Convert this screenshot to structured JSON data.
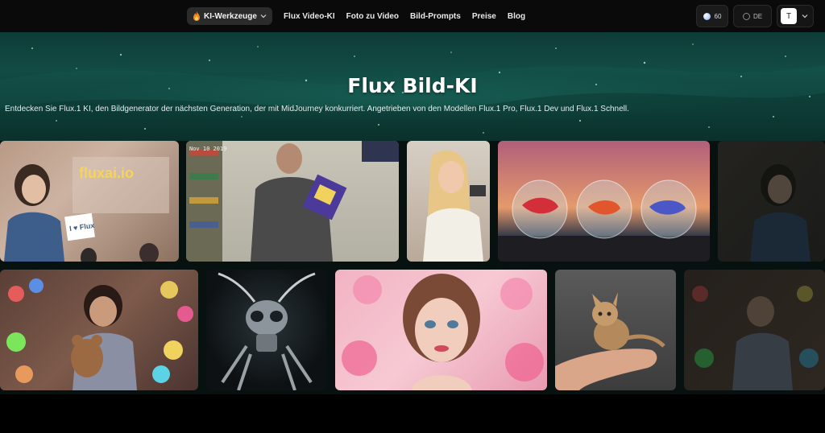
{
  "nav": {
    "items": [
      {
        "label": "KI-Werkzeuge",
        "icon": "flame-icon",
        "dropdown": true
      },
      {
        "label": "Flux Video-KI"
      },
      {
        "label": "Foto zu Video"
      },
      {
        "label": "Bild-Prompts"
      },
      {
        "label": "Preise"
      },
      {
        "label": "Blog"
      }
    ],
    "credits": "60",
    "language": "DE",
    "user_initial": "T"
  },
  "hero": {
    "title": "Flux Bild-KI",
    "subtitle": "Entdecken Sie Flux.1 KI, den Bildgenerator der nächsten Generation, der mit MidJourney konkurriert. Angetrieben von den Modellen Flux.1 Pro, Flux.1 Dev und Flux.1 Schnell."
  },
  "gallery": {
    "row1": [
      {
        "name": "woman-holding-flux-sign",
        "caption": "fluxai.io",
        "sign": "I ♥ Flux"
      },
      {
        "name": "man-with-snack-bag-cctv",
        "timestamp": "Nov 10 2019"
      },
      {
        "name": "woman-selfie"
      },
      {
        "name": "three-fishbowls-bettas"
      },
      {
        "name": "woman-partial-faded"
      }
    ],
    "row2": [
      {
        "name": "girl-with-teddy-bear"
      },
      {
        "name": "robot-ant"
      },
      {
        "name": "woman-with-pink-flowers"
      },
      {
        "name": "kitten-on-finger"
      },
      {
        "name": "girl-with-toys-faded"
      }
    ]
  },
  "colors": {
    "background": "#050505",
    "hero_teal": "#124c44",
    "nav_pill": "#2b2b2b"
  }
}
